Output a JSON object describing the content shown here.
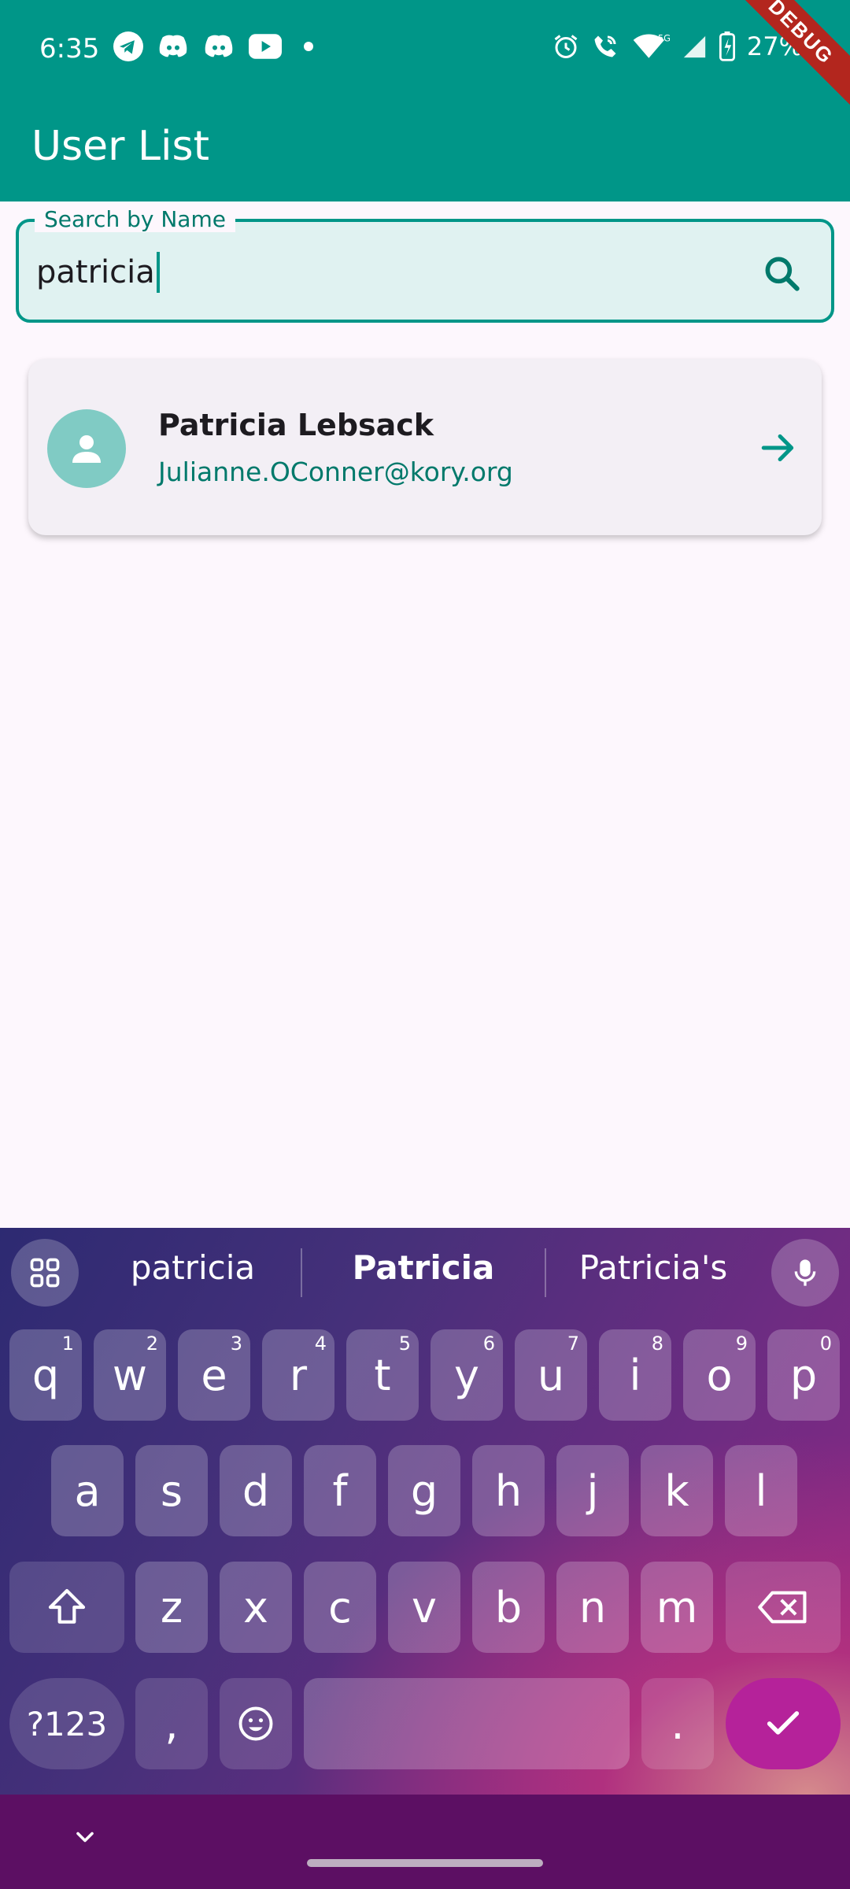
{
  "status_bar": {
    "time": "6:35",
    "battery": "27%",
    "network": "5G+",
    "left_icons": [
      "telegram-icon",
      "discord-icon",
      "discord-icon",
      "youtube-icon",
      "dot"
    ],
    "right_icons": [
      "alarm-icon",
      "wifi-call-icon",
      "wifi-icon",
      "signal-icon",
      "battery-charging-icon"
    ]
  },
  "debug_banner": "DEBUG",
  "app_bar": {
    "title": "User List"
  },
  "search": {
    "label": "Search by Name",
    "value": "patricia"
  },
  "users": [
    {
      "name": "Patricia Lebsack",
      "email": "Julianne.OConner@kory.org"
    }
  ],
  "keyboard": {
    "suggestions": [
      "patricia",
      "Patricia",
      "Patricia's"
    ],
    "row1": [
      {
        "k": "q",
        "h": "1"
      },
      {
        "k": "w",
        "h": "2"
      },
      {
        "k": "e",
        "h": "3"
      },
      {
        "k": "r",
        "h": "4"
      },
      {
        "k": "t",
        "h": "5"
      },
      {
        "k": "y",
        "h": "6"
      },
      {
        "k": "u",
        "h": "7"
      },
      {
        "k": "i",
        "h": "8"
      },
      {
        "k": "o",
        "h": "9"
      },
      {
        "k": "p",
        "h": "0"
      }
    ],
    "row2": [
      "a",
      "s",
      "d",
      "f",
      "g",
      "h",
      "j",
      "k",
      "l"
    ],
    "row3": [
      "z",
      "x",
      "c",
      "v",
      "b",
      "n",
      "m"
    ],
    "symbols_key": "?123",
    "comma_key": ",",
    "period_key": "."
  },
  "colors": {
    "primary": "#009688",
    "accent_text": "#00796b",
    "background": "#fdf7fd",
    "card": "#f3eff5"
  }
}
